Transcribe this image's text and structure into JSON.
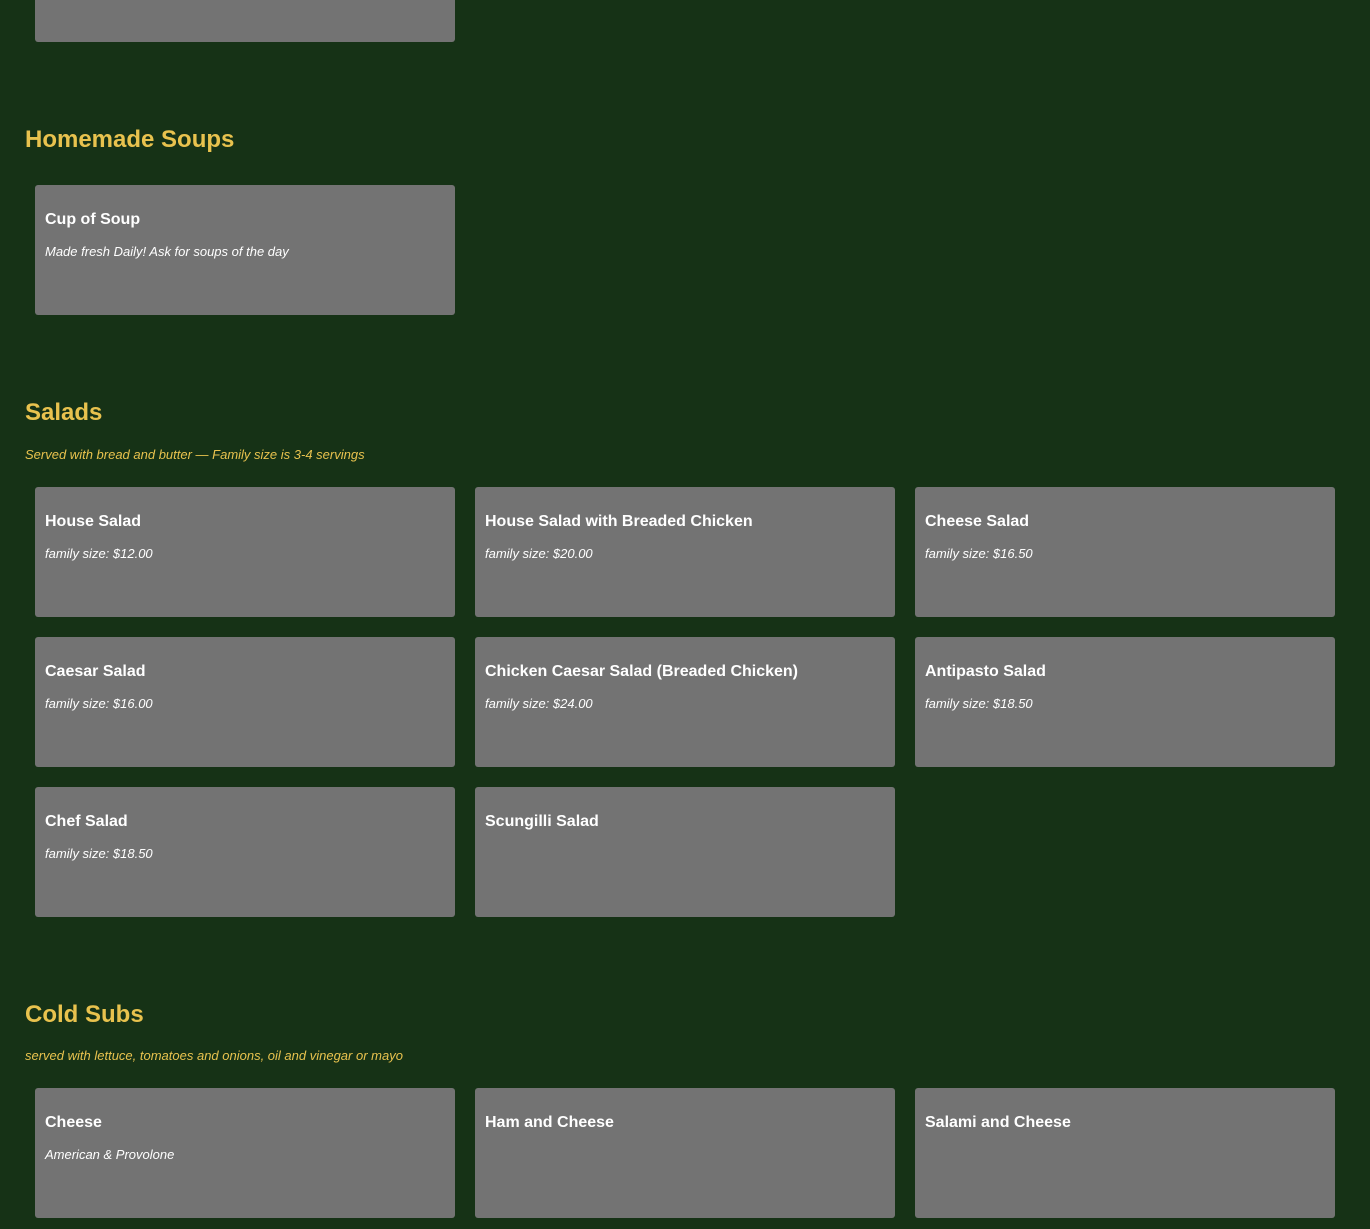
{
  "sections": [
    {
      "title": "Homemade Soups",
      "note": "",
      "items": [
        {
          "name": "Cup of Soup",
          "desc": "Made fresh Daily! Ask for soups of the day"
        }
      ]
    },
    {
      "title": "Salads",
      "note": "Served with bread and butter — Family size is 3-4 servings",
      "items": [
        {
          "name": "House Salad",
          "desc": "family size: $12.00"
        },
        {
          "name": "House Salad with Breaded Chicken",
          "desc": "family size: $20.00"
        },
        {
          "name": "Cheese Salad",
          "desc": "family size: $16.50"
        },
        {
          "name": "Caesar Salad",
          "desc": "family size: $16.00"
        },
        {
          "name": "Chicken Caesar Salad (Breaded Chicken)",
          "desc": "family size: $24.00"
        },
        {
          "name": "Antipasto Salad",
          "desc": "family size: $18.50"
        },
        {
          "name": "Chef Salad",
          "desc": "family size: $18.50"
        },
        {
          "name": "Scungilli Salad",
          "desc": ""
        }
      ]
    },
    {
      "title": "Cold Subs",
      "note": "served with lettuce, tomatoes and onions, oil and vinegar or mayo",
      "items": [
        {
          "name": "Cheese",
          "desc": "American & Provolone"
        },
        {
          "name": "Ham and Cheese",
          "desc": ""
        },
        {
          "name": "Salami and Cheese",
          "desc": ""
        }
      ]
    }
  ],
  "colors": {
    "background": "#163216",
    "card": "#737373",
    "accent": "#e8c24e",
    "text": "#ffffff"
  }
}
